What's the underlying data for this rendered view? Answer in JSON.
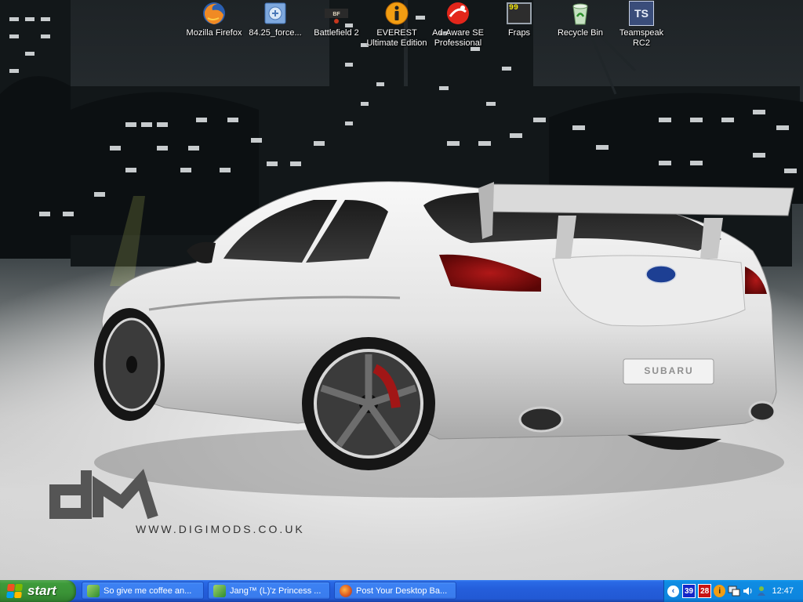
{
  "desktop": {
    "icons": [
      {
        "label": "Mozilla Firefox",
        "icon": "firefox-icon"
      },
      {
        "label": "84.25_force...",
        "icon": "document-icon"
      },
      {
        "label": "Battlefield 2",
        "icon": "battlefield-icon"
      },
      {
        "label": "EVEREST Ultimate Edition",
        "line1": "EVEREST",
        "line2": "Ultimate Edition",
        "icon": "info-icon"
      },
      {
        "label": "Ad-Aware SE Professional",
        "line1": "Ad-Aware SE",
        "line2": "Professional",
        "icon": "adaware-icon"
      },
      {
        "label": "Fraps",
        "icon": "fraps-icon",
        "badge": "99"
      },
      {
        "label": "Recycle Bin",
        "icon": "recycle-bin-icon"
      },
      {
        "label": "Teamspeak RC2",
        "line1": "Teamspeak",
        "line2": "RC2",
        "icon": "teamspeak-icon",
        "badge": "TS"
      }
    ],
    "wallpaper": {
      "brand_text": "SUBARU",
      "logo_text": "dM",
      "site_text": "WWW.DIGIMODS.CO.UK"
    }
  },
  "taskbar": {
    "start_label": "start",
    "tasks": [
      {
        "label": "So give me coffee an...",
        "icon": "messenger-icon"
      },
      {
        "label": "Jang™ (L)'z Princess ...",
        "icon": "messenger-icon"
      },
      {
        "label": "Post Your Desktop Ba...",
        "icon": "firefox-icon"
      }
    ],
    "tray": {
      "badge_blue": "39",
      "badge_red": "28",
      "clock": "12:47"
    }
  },
  "colors": {
    "taskbar_blue": "#245edb",
    "start_green": "#3a9236",
    "tray_blue": "#0f8ce3"
  }
}
